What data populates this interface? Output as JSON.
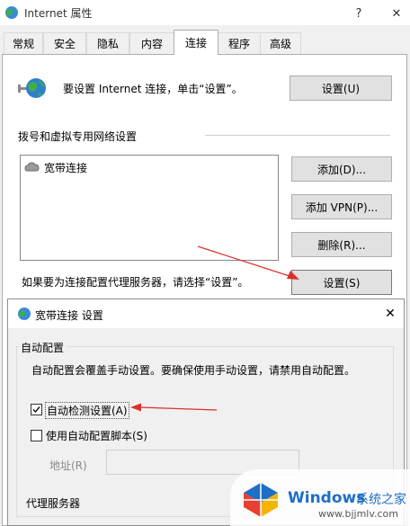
{
  "window": {
    "title": "Internet 属性",
    "help_label": "?",
    "close_label": "✕"
  },
  "tabs": [
    {
      "label": "常规"
    },
    {
      "label": "安全"
    },
    {
      "label": "隐私"
    },
    {
      "label": "内容"
    },
    {
      "label": "连接"
    },
    {
      "label": "程序"
    },
    {
      "label": "高级"
    }
  ],
  "connections": {
    "setup_text": "要设置 Internet 连接，单击“设置”。",
    "setup_button": "设置(U)",
    "dialup_group_label": "拨号和虚拟专用网络设置",
    "list_items": [
      {
        "label": "宽带连接"
      }
    ],
    "add_button": "添加(D)...",
    "add_vpn_button": "添加 VPN(P)...",
    "remove_button": "删除(R)...",
    "proxy_text": "如果要为连接配置代理服务器，请选择“设置”。",
    "settings_button": "设置(S)"
  },
  "dialog": {
    "title": "宽带连接 设置",
    "close_label": "✕",
    "auto_config_group": "自动配置",
    "auto_config_desc": "自动配置会覆盖手动设置。要确保使用手动设置，请禁用自动配置。",
    "auto_detect_label": "自动检测设置(A)",
    "auto_detect_checked": true,
    "use_script_label": "使用自动配置脚本(S)",
    "use_script_checked": false,
    "address_label": "地址(R)",
    "address_value": "",
    "proxy_group": "代理服务器"
  },
  "watermark": {
    "brand": "Windows",
    "brand_cn": "系统之家",
    "url": "www.bjjmlv.com"
  },
  "colors": {
    "annotation_red": "#d9302a",
    "brand_blue": "#1e6fc6"
  }
}
